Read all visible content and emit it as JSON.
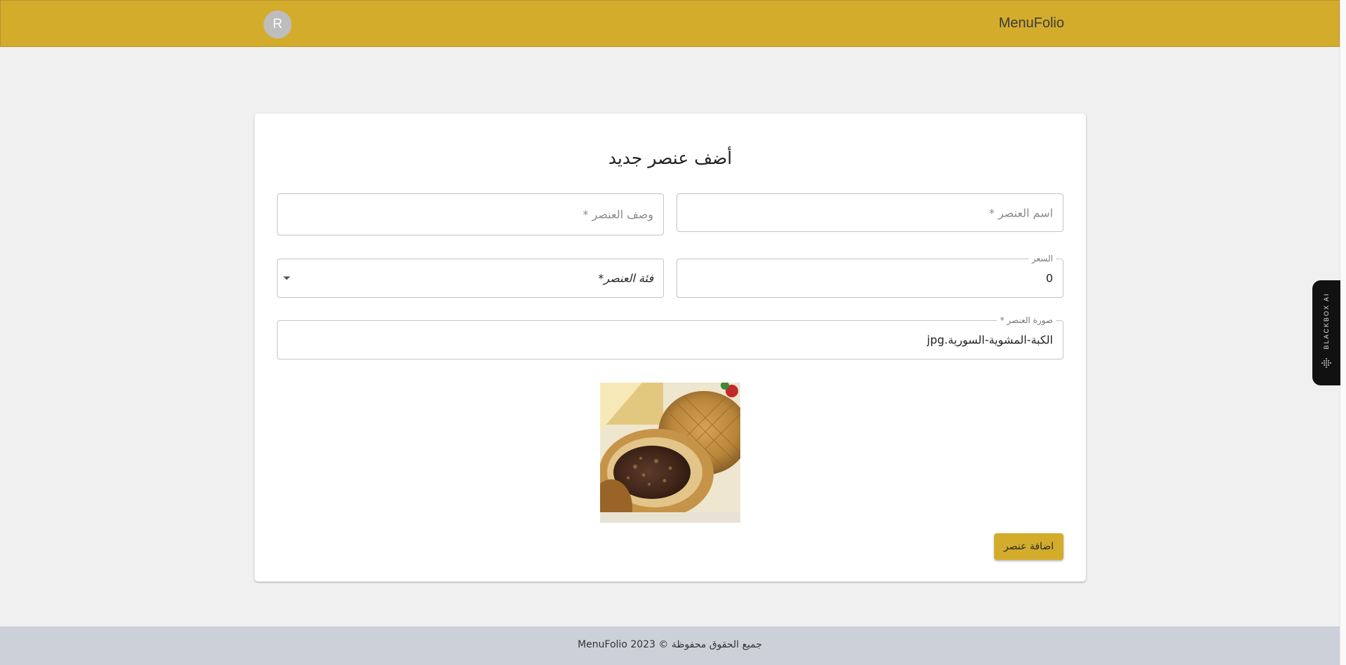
{
  "header": {
    "brand": "MenuFolio",
    "avatar_letter": "R",
    "color": "#d4ac2c"
  },
  "form": {
    "title": "أضف عنصر جديد",
    "item_name": {
      "placeholder": "اسم العنصر *",
      "value": ""
    },
    "item_description": {
      "placeholder": "وصف العنصر *",
      "value": ""
    },
    "price": {
      "label": "السعر",
      "value": "0"
    },
    "category": {
      "value": "فئة العنصر*"
    },
    "image": {
      "label": "صورة العنصر *",
      "value": "الكبة-المشوية-السورية.jpg"
    },
    "image_preview_icon": "food-photo",
    "submit_label": "اضافة عنصر"
  },
  "footer": {
    "text": "جميع الحقوق محفوظة © 2023 MenuFolio"
  },
  "side_widget": {
    "label": "BLACKBOX AI"
  }
}
